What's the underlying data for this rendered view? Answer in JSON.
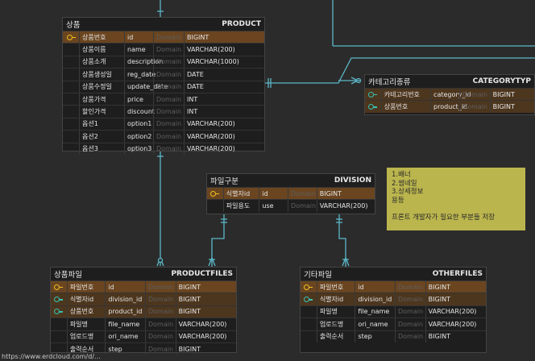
{
  "entities": {
    "product": {
      "logical": "상품",
      "physical": "PRODUCT",
      "rows": [
        {
          "key": "pk",
          "ln": "상품번호",
          "pn": "id",
          "dm": "Domain",
          "ty": "BIGINT"
        },
        {
          "key": "",
          "ln": "상품이름",
          "pn": "name",
          "dm": "Domain",
          "ty": "VARCHAR(200)"
        },
        {
          "key": "",
          "ln": "상품소개",
          "pn": "description",
          "dm": "Domain",
          "ty": "VARCHAR(1000)"
        },
        {
          "key": "",
          "ln": "상품생성일",
          "pn": "reg_date",
          "dm": "Domain",
          "ty": "DATE"
        },
        {
          "key": "",
          "ln": "상품수정일",
          "pn": "update_date",
          "dm": "Domain",
          "ty": "DATE"
        },
        {
          "key": "",
          "ln": "상품가격",
          "pn": "price",
          "dm": "Domain",
          "ty": "INT"
        },
        {
          "key": "",
          "ln": "할인가격",
          "pn": "discount",
          "dm": "Domain",
          "ty": "INT"
        },
        {
          "key": "",
          "ln": "옵션1",
          "pn": "option1",
          "dm": "Domain",
          "ty": "VARCHAR(200)"
        },
        {
          "key": "",
          "ln": "옵션2",
          "pn": "option2",
          "dm": "Domain",
          "ty": "VARCHAR(200)"
        },
        {
          "key": "",
          "ln": "옵션3",
          "pn": "option3",
          "dm": "Domain",
          "ty": "VARCHAR(200)"
        }
      ]
    },
    "categorytype": {
      "logical": "카테고리종류",
      "physical": "CATEGORYTYP",
      "rows": [
        {
          "key": "fk",
          "ln": "카테고리번호",
          "pn": "category_id",
          "dm": "Domain",
          "ty": "BIGINT"
        },
        {
          "key": "fk",
          "ln": "상품번호",
          "pn": "product_id",
          "dm": "Domain",
          "ty": "BIGINT"
        }
      ]
    },
    "division": {
      "logical": "파일구분",
      "physical": "DIVISION",
      "rows": [
        {
          "key": "pk",
          "ln": "식별자id",
          "pn": "id",
          "dm": "Domain",
          "ty": "BIGINT"
        },
        {
          "key": "",
          "ln": "파일용도",
          "pn": "use",
          "dm": "Domain",
          "ty": "VARCHAR(200)"
        }
      ]
    },
    "productfiles": {
      "logical": "상품파일",
      "physical": "PRODUCTFILES",
      "rows": [
        {
          "key": "pk",
          "ln": "파일번호",
          "pn": "id",
          "dm": "Domain",
          "ty": "BIGINT"
        },
        {
          "key": "fk",
          "ln": "식별자id",
          "pn": "division_id",
          "dm": "Domain",
          "ty": "BIGINT"
        },
        {
          "key": "fk",
          "ln": "상품번호",
          "pn": "product_id",
          "dm": "Domain",
          "ty": "BIGINT"
        },
        {
          "key": "",
          "ln": "파일명",
          "pn": "file_name",
          "dm": "Domain",
          "ty": "VARCHAR(200)"
        },
        {
          "key": "",
          "ln": "업로드명",
          "pn": "ori_name",
          "dm": "Domain",
          "ty": "VARCHAR(200)"
        },
        {
          "key": "",
          "ln": "출력순서",
          "pn": "step",
          "dm": "Domain",
          "ty": "BIGINT"
        }
      ]
    },
    "otherfiles": {
      "logical": "기타파일",
      "physical": "OTHERFILES",
      "rows": [
        {
          "key": "pk",
          "ln": "파일번호",
          "pn": "id",
          "dm": "Domain",
          "ty": "BIGINT"
        },
        {
          "key": "fk",
          "ln": "식별자id",
          "pn": "division_id",
          "dm": "Domain",
          "ty": "BIGINT"
        },
        {
          "key": "",
          "ln": "파일명",
          "pn": "file_name",
          "dm": "Domain",
          "ty": "VARCHAR(200)"
        },
        {
          "key": "",
          "ln": "업로드명",
          "pn": "ori_name",
          "dm": "Domain",
          "ty": "VARCHAR(200)"
        },
        {
          "key": "",
          "ln": "출력순서",
          "pn": "step",
          "dm": "Domain",
          "ty": "BIGINT"
        }
      ]
    }
  },
  "note": {
    "lines": [
      "1.배너",
      "2.썸네일",
      "3.상세정보",
      "용등",
      "",
      "프론트 개발자가 필요한 부분들 저장"
    ]
  },
  "bottom_text": "https://www.erdcloud.com/d/...",
  "colors": {
    "background": "#2b2b2b",
    "relation_line": "#5bb8c8",
    "pk_row": "#6a4520",
    "fk_row": "#4d361e",
    "pk_key": "#f0c020",
    "fk_key": "#35c3b4",
    "note_bg": "#bbb54e"
  }
}
